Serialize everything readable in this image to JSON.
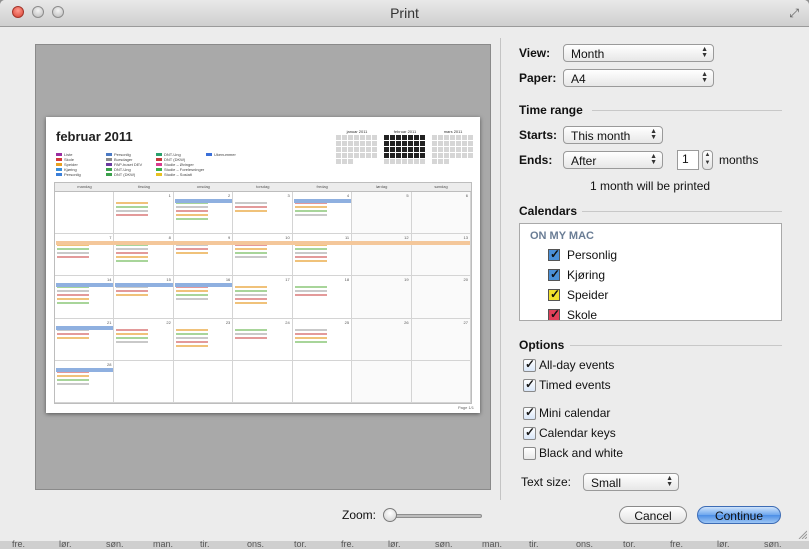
{
  "window": {
    "title": "Print"
  },
  "preview": {
    "month_title": "februar 2011",
    "legend": [
      {
        "label": "Liste",
        "color": "#9b2ea0"
      },
      {
        "label": "Skole",
        "color": "#d33a3a"
      },
      {
        "label": "Speider",
        "color": "#e8a021"
      },
      {
        "label": "Kjøring",
        "color": "#3a8fd9"
      },
      {
        "label": "Personlig",
        "color": "#3a7fd9"
      },
      {
        "label": "Personlig",
        "color": "#4b7ac4"
      },
      {
        "label": "Bursdager",
        "color": "#8a8a8a"
      },
      {
        "label": "PAP-huset DEV",
        "color": "#6a3aa0"
      },
      {
        "label": "DNT-Ung",
        "color": "#3aa04b"
      },
      {
        "label": "DNT (DKW)",
        "color": "#3aa04b"
      },
      {
        "label": "DNT-Ung",
        "color": "#2aa06b"
      },
      {
        "label": "DNT (DKW)",
        "color": "#c43a3a"
      },
      {
        "label": "Studie – Øvinger",
        "color": "#d93a8f"
      },
      {
        "label": "Studie – Forelesninger",
        "color": "#3ab04b"
      },
      {
        "label": "Studie – Sosialt",
        "color": "#e8c121"
      },
      {
        "label": "Ukenummer",
        "color": "#3a6fd9"
      }
    ],
    "mini_months": [
      "januar 2011",
      "februar 2011",
      "mars 2011"
    ],
    "weekdays": [
      "mandag",
      "tirsdag",
      "onsdag",
      "torsdag",
      "fredag",
      "lørdag",
      "søndag"
    ],
    "weeks": [
      [
        "",
        "1",
        "2",
        "3",
        "4",
        "5",
        "6"
      ],
      [
        "7",
        "8",
        "9",
        "10",
        "11",
        "12",
        "13"
      ],
      [
        "14",
        "15",
        "16",
        "17",
        "18",
        "19",
        "20"
      ],
      [
        "21",
        "22",
        "23",
        "24",
        "25",
        "26",
        "27"
      ],
      [
        "28",
        "",
        "",
        "",
        "",
        "",
        ""
      ]
    ],
    "page_number": "Page 1/1"
  },
  "form": {
    "view_label": "View:",
    "view_value": "Month",
    "paper_label": "Paper:",
    "paper_value": "A4",
    "time_range_heading": "Time range",
    "starts_label": "Starts:",
    "starts_value": "This month",
    "ends_label": "Ends:",
    "ends_value": "After",
    "ends_count": "1",
    "ends_unit": "months",
    "summary": "1 month will be printed",
    "calendars_heading": "Calendars",
    "calendars_group": "ON MY MAC",
    "calendars": [
      {
        "name": "Personlig",
        "color": "#4a90d9",
        "checked": true
      },
      {
        "name": "Kjøring",
        "color": "#4a90d9",
        "checked": true
      },
      {
        "name": "Speider",
        "color": "#f2e12b",
        "checked": true
      },
      {
        "name": "Skole",
        "color": "#e0405a",
        "checked": true
      }
    ],
    "options_heading": "Options",
    "options": [
      {
        "label": "All-day events",
        "checked": true
      },
      {
        "label": "Timed events",
        "checked": true
      },
      {
        "label": "Mini calendar",
        "checked": true
      },
      {
        "label": "Calendar keys",
        "checked": true
      },
      {
        "label": "Black and white",
        "checked": false
      }
    ],
    "text_size_label": "Text size:",
    "text_size_value": "Small"
  },
  "footer": {
    "zoom_label": "Zoom:",
    "zoom_level": 0,
    "cancel_label": "Cancel",
    "continue_label": "Continue"
  },
  "background_days": [
    "fre.",
    "lør.",
    "søn.",
    "man.",
    "tir.",
    "ons.",
    "tor.",
    "fre.",
    "lør.",
    "søn.",
    "man.",
    "tir.",
    "ons.",
    "tor.",
    "fre.",
    "lør.",
    "søn."
  ]
}
